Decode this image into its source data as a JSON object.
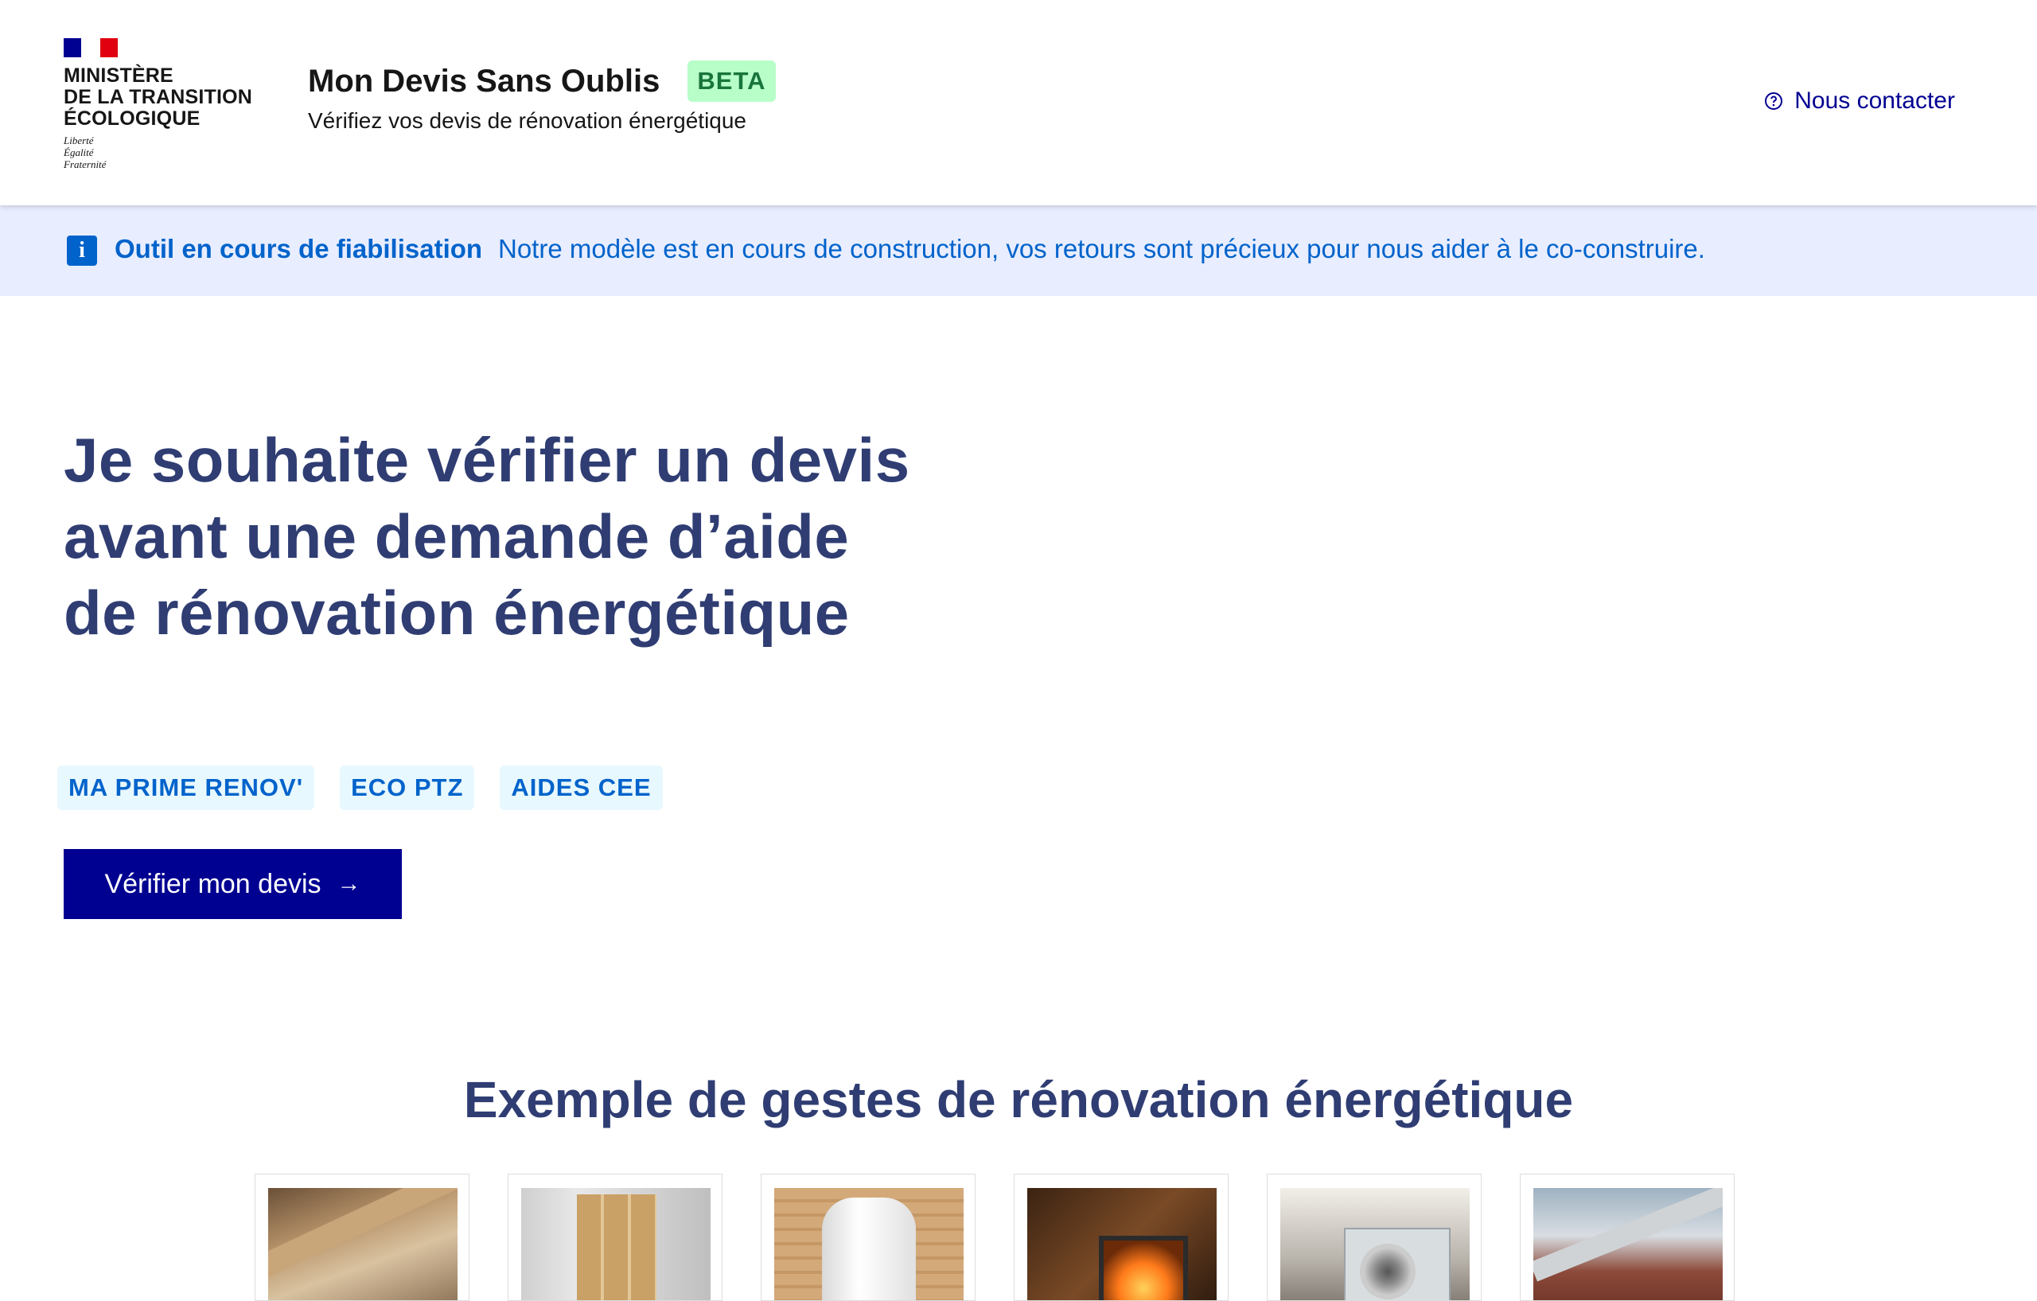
{
  "header": {
    "logo": {
      "ministry_lines": [
        "MINISTÈRE",
        "DE LA TRANSITION",
        "ÉCOLOGIQUE"
      ],
      "motto_lines": [
        "Liberté",
        "Égalité",
        "Fraternité"
      ]
    },
    "service_title": "Mon Devis Sans Oublis",
    "beta_badge": "BETA",
    "service_tagline": "Vérifiez vos devis de rénovation énergétique",
    "contact_label": "Nous contacter",
    "contact_icon": "question-circle-icon"
  },
  "notice": {
    "icon": "info-icon",
    "title": "Outil en cours de fiabilisation",
    "text": "Notre modèle est en cours de construction, vos retours sont précieux pour nous aider à le co-construire."
  },
  "hero": {
    "title": "Je souhaite vérifier un devis avant une demande d’aide de rénovation énergétique",
    "tags": [
      "MA PRIME RENOV'",
      "ECO PTZ",
      "AIDES CEE"
    ],
    "cta_label": "Vérifier mon devis",
    "cta_icon": "arrow-right-icon"
  },
  "examples": {
    "title": "Exemple de gestes de rénovation énergétique",
    "cards": [
      {
        "image": "roof-insulation-image"
      },
      {
        "image": "window-door-image"
      },
      {
        "image": "water-heater-image"
      },
      {
        "image": "wood-stove-image"
      },
      {
        "image": "heat-pump-image"
      },
      {
        "image": "roof-pipe-image"
      }
    ]
  },
  "colors": {
    "primary": "#000091",
    "title": "#2f3d73",
    "info": "#0063cb",
    "notice_bg": "#e8edff",
    "beta_bg": "#b8fec9",
    "beta_text": "#18753c",
    "tag_bg": "#e8f8ff"
  }
}
